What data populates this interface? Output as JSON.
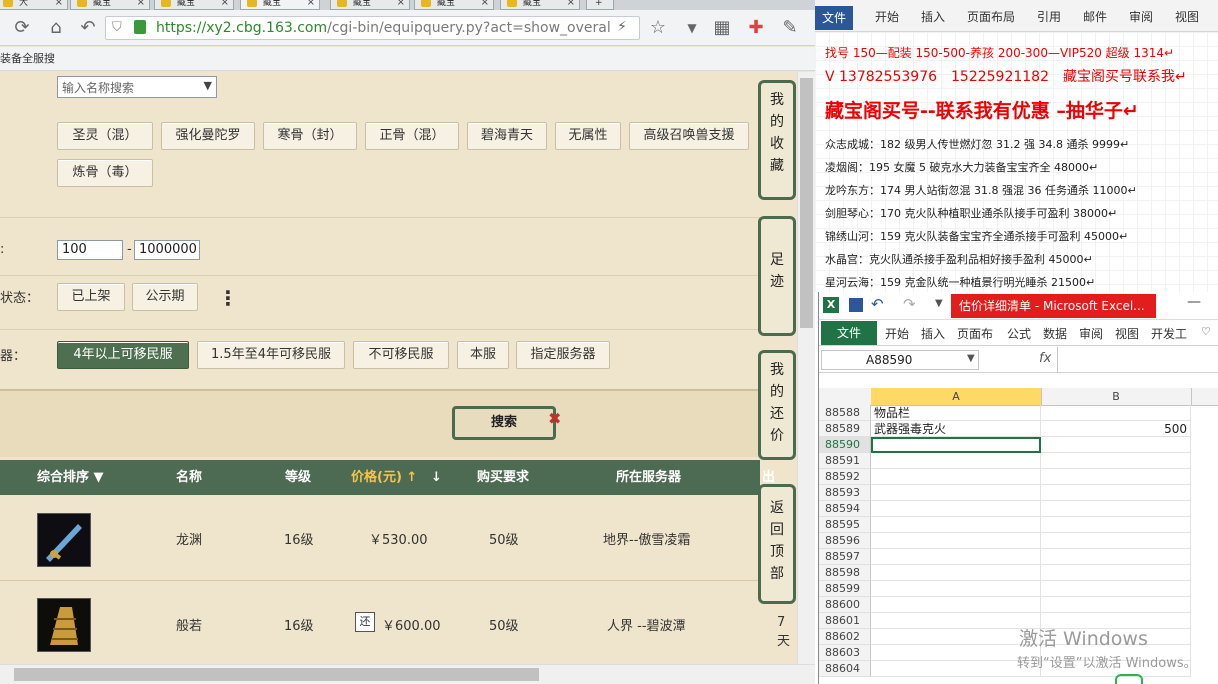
{
  "browser": {
    "tabs": [
      {
        "label": "大"
      },
      {
        "label": "藏宝"
      },
      {
        "label": "藏宝"
      },
      {
        "label": "藏宝"
      },
      {
        "label": "藏宝"
      },
      {
        "label": "藏宝"
      },
      {
        "label": "藏宝"
      }
    ],
    "url_scheme": "https://",
    "url_host": "xy2.cbg.163.com",
    "url_path": "/cgi-bin/equipquery.py?act=show_overall_se",
    "bookmark_label": "装备全服搜"
  },
  "filters": {
    "search_placeholder": "输入名称搜索",
    "attr_buttons": [
      "圣灵（混）",
      "强化曼陀罗",
      "寒骨（封）",
      "正骨（混）",
      "碧海青天",
      "无属性",
      "高级召唤兽支援",
      "炼骨（毒）"
    ],
    "price_label": ":",
    "price_min": "100",
    "price_dash": "-",
    "price_max": "1000000",
    "status_label": "状态：",
    "status_buttons": [
      "已上架",
      "公示期"
    ],
    "more_label": "⋮",
    "server_label": "器：",
    "server_buttons": [
      "4年以上可移民服",
      "1.5年至4年可移民服",
      "不可移民服",
      "本服",
      "指定服务器"
    ],
    "search_button": "搜索"
  },
  "table": {
    "headers": {
      "sort": "综合排序 ▼",
      "name": "名称",
      "level": "等级",
      "price": "价格(元) ↑",
      "price_down": "↓",
      "req": "购买要求",
      "server": "所在服务器",
      "extra": "出售"
    },
    "rows": [
      {
        "name": "龙渊",
        "level": "16级",
        "price": "￥530.00",
        "req": "50级",
        "server": "地界--傲雪凌霜",
        "extra": "",
        "badge": ""
      },
      {
        "name": "般若",
        "level": "16级",
        "price": "￥600.00",
        "req": "50级",
        "server": "人界 --碧波潭",
        "extra": "7天",
        "badge": "还"
      }
    ]
  },
  "side_nav": [
    {
      "label": "我的收藏"
    },
    {
      "label": "足迹"
    },
    {
      "label": "我的还价"
    },
    {
      "label": "返回顶部"
    }
  ],
  "word": {
    "file_tab": "文件",
    "tabs": [
      "开始",
      "插入",
      "页面布局",
      "引用",
      "邮件",
      "审阅",
      "视图"
    ],
    "lines": [
      {
        "text": "找号 150—配装 150-500-养孩 200-300—VIP520 超级 1314↵",
        "style": "red-small"
      },
      {
        "text": "V 13782553976　15225921182　藏宝阁买号联系我↵",
        "style": "red-mid"
      },
      {
        "text": "藏宝阁买号--联系我有优惠 –抽华子↵",
        "style": "red-big"
      },
      {
        "text": "众志成城：182 级男人传世燃灯忽 31.2 强 34.8 通杀 9999↵",
        "style": "normal"
      },
      {
        "text": "凌烟阁：195 女魔 5 破克水大力装备宝宝齐全 48000↵",
        "style": "normal"
      },
      {
        "text": "龙吟东方：174 男人站街忽混 31.8 强混 36 任务通杀 11000↵",
        "style": "normal"
      },
      {
        "text": "剑胆琴心：170 克火队种植职业通杀队接手可盈利 38000↵",
        "style": "normal"
      },
      {
        "text": "锦绣山河：159 克火队装备宝宝齐全通杀接手可盈利 45000↵",
        "style": "normal"
      },
      {
        "text": "水晶宫：克火队通杀接手盈利品相好接手盈利 45000↵",
        "style": "normal"
      },
      {
        "text": "星河云海：159 克金队统一种植景行明光睡杀 21500↵",
        "style": "normal"
      }
    ]
  },
  "excel": {
    "title": "估价详细清单 - Microsoft Excel...",
    "close": "—",
    "file_tab": "文件",
    "tabs": [
      "开始",
      "插入",
      "页面布",
      "公式",
      "数据",
      "审阅",
      "视图",
      "开发工"
    ],
    "name_box": "A88590",
    "fx": "fx",
    "col_a": "A",
    "col_b": "B",
    "rows": [
      {
        "num": "88588",
        "a": "物品栏",
        "b": ""
      },
      {
        "num": "88589",
        "a": "武器强毒克火",
        "b": "500"
      },
      {
        "num": "88590",
        "a": "",
        "b": ""
      },
      {
        "num": "88591",
        "a": "",
        "b": ""
      },
      {
        "num": "88592",
        "a": "",
        "b": ""
      },
      {
        "num": "88593",
        "a": "",
        "b": ""
      },
      {
        "num": "88594",
        "a": "",
        "b": ""
      },
      {
        "num": "88595",
        "a": "",
        "b": ""
      },
      {
        "num": "88596",
        "a": "",
        "b": ""
      },
      {
        "num": "88597",
        "a": "",
        "b": ""
      },
      {
        "num": "88598",
        "a": "",
        "b": ""
      },
      {
        "num": "88599",
        "a": "",
        "b": ""
      },
      {
        "num": "88600",
        "a": "",
        "b": ""
      },
      {
        "num": "88601",
        "a": "",
        "b": ""
      },
      {
        "num": "88602",
        "a": "",
        "b": ""
      },
      {
        "num": "88603",
        "a": "",
        "b": ""
      },
      {
        "num": "88604",
        "a": "",
        "b": ""
      }
    ]
  },
  "watermark": {
    "line1": "激活 Windows",
    "line2": "转到“设置”以激活 Windows。"
  },
  "colors": {
    "accent_green": "#4e7050",
    "excel_green": "#217346",
    "word_blue": "#2b579a",
    "alert_red": "#e31c1c"
  }
}
